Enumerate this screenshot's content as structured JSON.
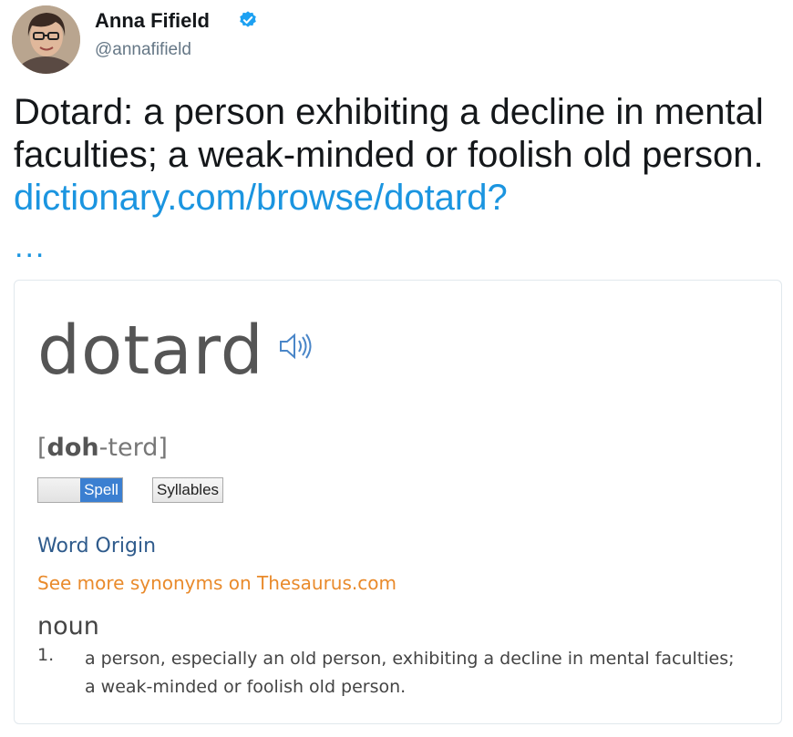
{
  "tweet": {
    "author_name": "Anna Fifield",
    "author_handle": "@annafifield",
    "text": "Dotard: a person exhibiting a decline in mental faculties; a weak-minded or foolish old person.",
    "link": "dictionary.com/browse/dotard?",
    "ellipsis": "...",
    "verified_icon": "verified-badge-icon",
    "link_color": "#1b95e0"
  },
  "card": {
    "word": "dotard",
    "speaker_icon": "speaker-icon",
    "pronunciation": {
      "open": "[",
      "stressed": "doh",
      "rest": "-terd",
      "close": "]"
    },
    "toggle_spell": "Spell",
    "toggle_syllables": "Syllables",
    "word_origin": "Word Origin",
    "synonyms_link": "See more synonyms on Thesaurus.com",
    "part_of_speech": "noun",
    "definitions": [
      {
        "number": "1.",
        "text": "a person, especially an old person, exhibiting a decline in mental faculties; a weak-minded or foolish old person."
      }
    ],
    "colors": {
      "origin": "#2f5b8c",
      "synonyms": "#e98a2b",
      "toggle_active": "#3b7fd1"
    }
  }
}
